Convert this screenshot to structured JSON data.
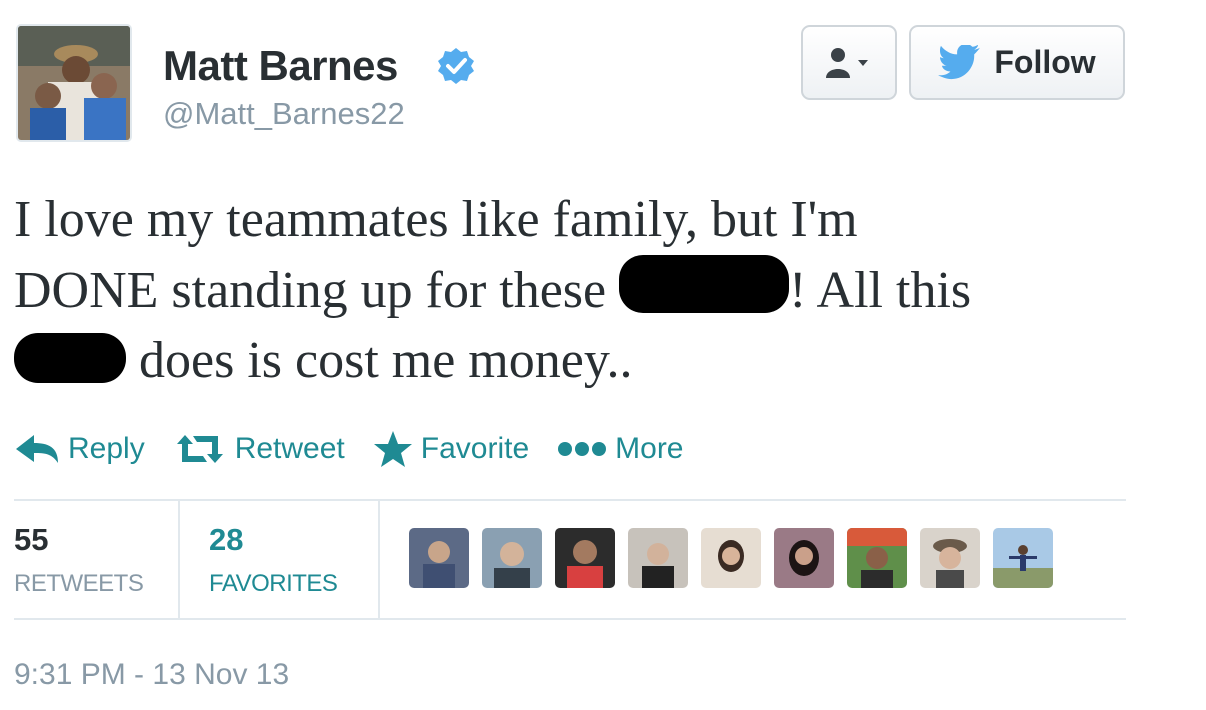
{
  "tweet": {
    "author_name": "Matt Barnes",
    "author_handle": "@Matt_Barnes22",
    "text_line1": "I love my teammates like family, but I'm",
    "text_line2_a": "DONE standing up for these ",
    "text_line2_b": "! All this",
    "text_line3": " does is cost me money..",
    "timestamp": "9:31 PM - 13 Nov 13"
  },
  "header": {
    "follow_label": "Follow"
  },
  "actions": {
    "reply": "Reply",
    "retweet": "Retweet",
    "favorite": "Favorite",
    "more": "More"
  },
  "stats": {
    "retweets_count": "55",
    "retweets_label": "RETWEETS",
    "favorites_count": "28",
    "favorites_label": "FAVORITES"
  },
  "colors": {
    "accent": "#1f8a93",
    "twitter_blue": "#55acee",
    "muted": "#8899a6",
    "text": "#292f33"
  }
}
